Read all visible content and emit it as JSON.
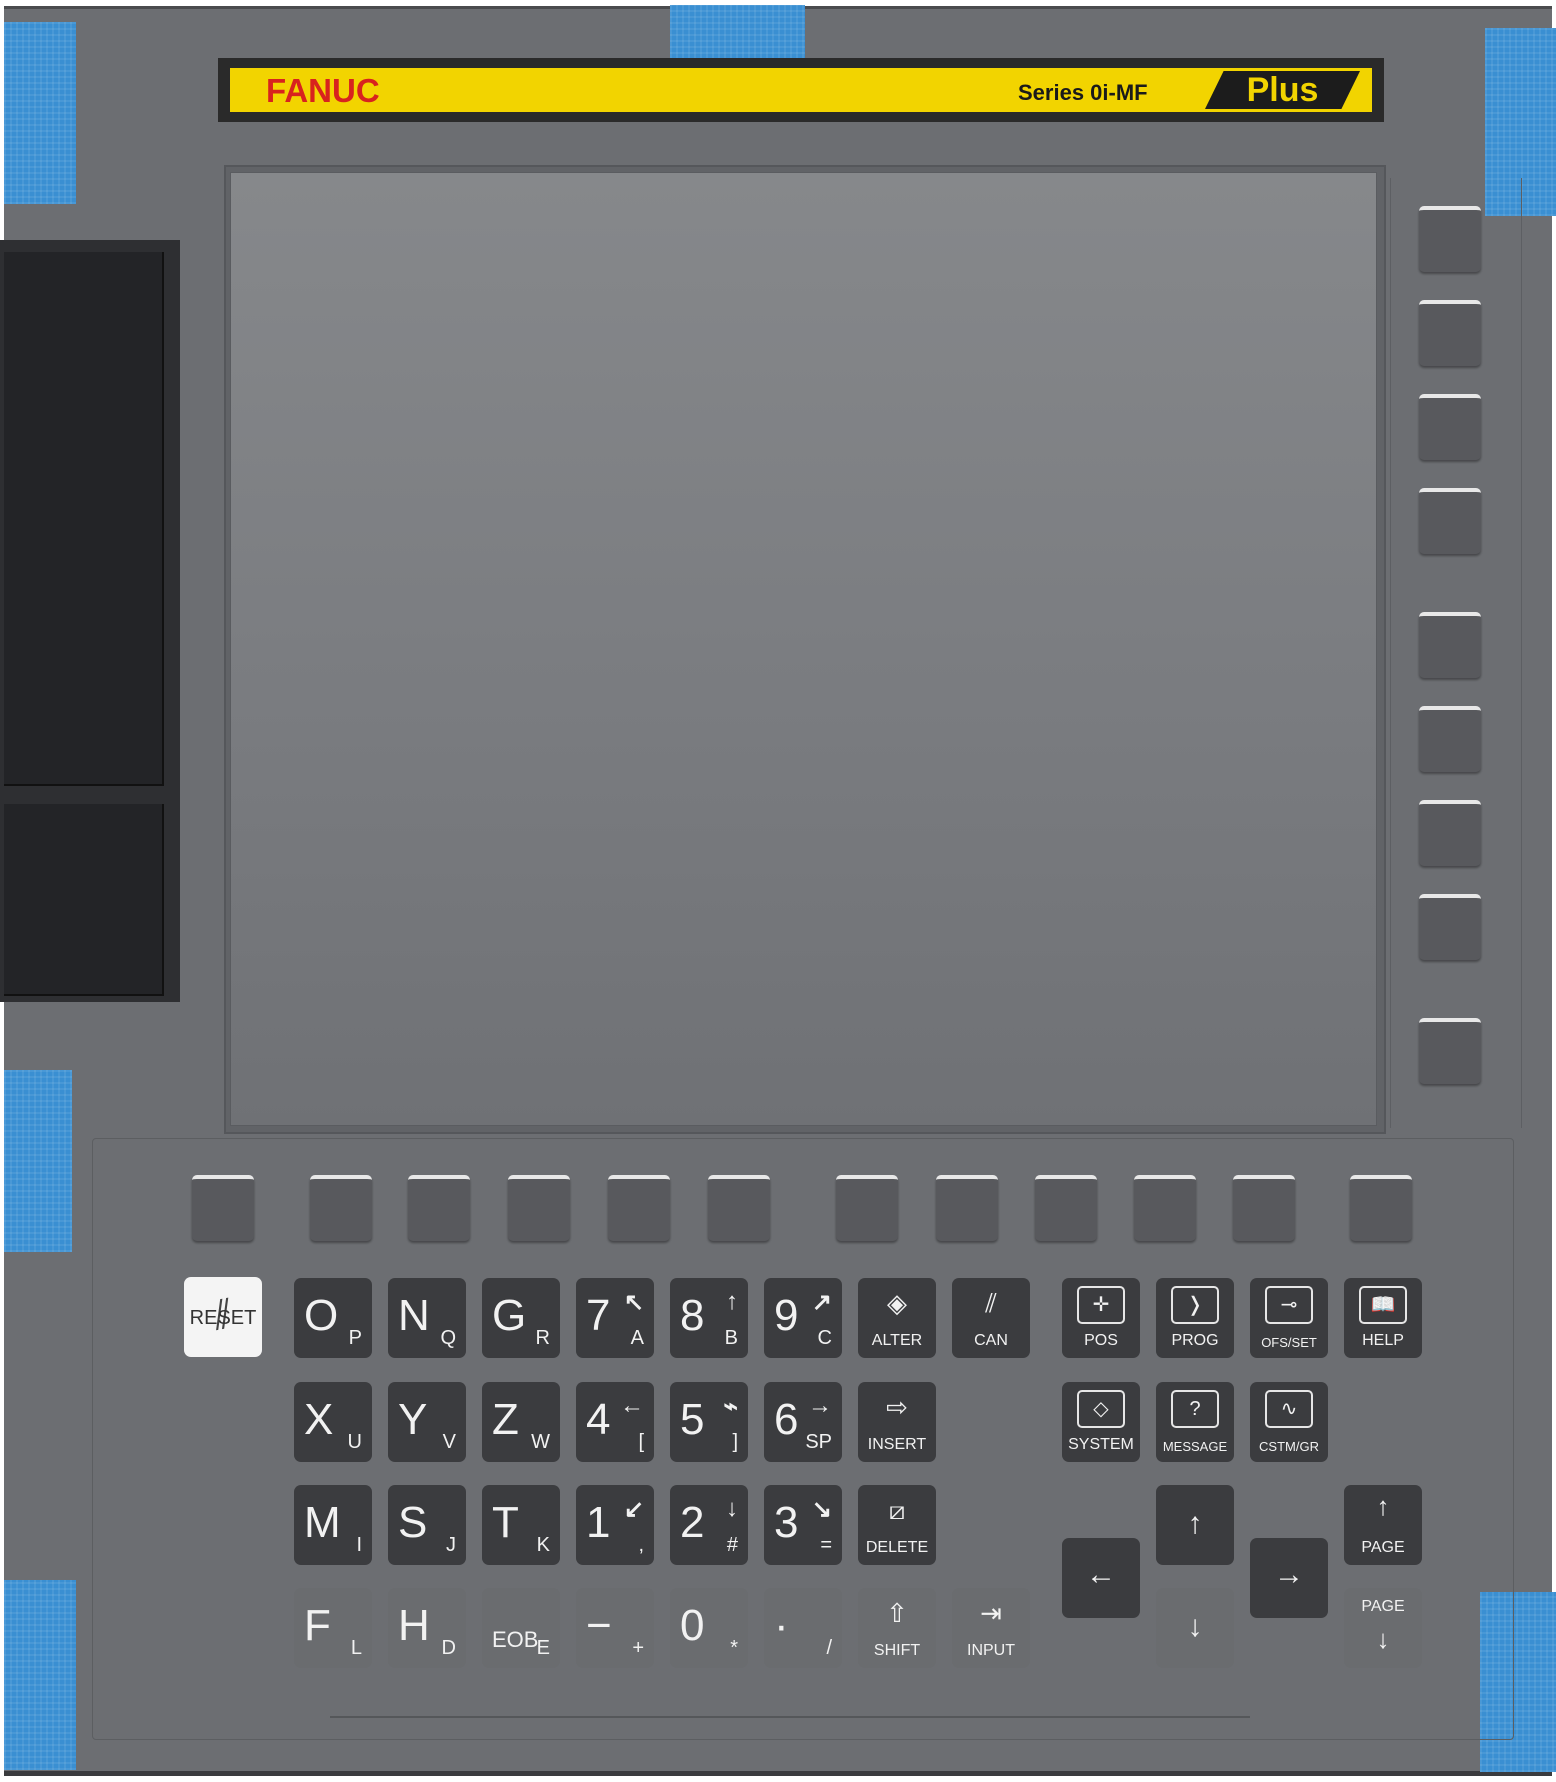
{
  "brand": {
    "logo": "FANUC",
    "series": "Series 0i-MF",
    "edition": "Plus",
    "colors": {
      "bar": "#f2d400",
      "logo": "#d8231e",
      "tape": "#3a8fd2"
    }
  },
  "screen": {
    "state": "off"
  },
  "right_softkeys": {
    "count": 9
  },
  "bottom_softkeys": {
    "count": 12
  },
  "reset": {
    "label": "RESET"
  },
  "address_keys": [
    {
      "main": "O",
      "sub": "P"
    },
    {
      "main": "N",
      "sub": "Q"
    },
    {
      "main": "G",
      "sub": "R"
    },
    {
      "main": "X",
      "sub": "U"
    },
    {
      "main": "Y",
      "sub": "V"
    },
    {
      "main": "Z",
      "sub": "W"
    },
    {
      "main": "M",
      "sub": "I"
    },
    {
      "main": "S",
      "sub": "J"
    },
    {
      "main": "T",
      "sub": "K"
    },
    {
      "main": "F",
      "sub": "L"
    },
    {
      "main": "H",
      "sub": "D"
    },
    {
      "main": "EOB",
      "sub": "E"
    }
  ],
  "numeric_keys": [
    {
      "main": "7",
      "sub": "A",
      "glyph": "↖"
    },
    {
      "main": "8",
      "sub": "B",
      "glyph": "↑"
    },
    {
      "main": "9",
      "sub": "C",
      "glyph": "↗"
    },
    {
      "main": "4",
      "sub": "[",
      "glyph": "←"
    },
    {
      "main": "5",
      "sub": "]",
      "glyph": "⌁"
    },
    {
      "main": "6",
      "sub": "SP",
      "glyph": "→"
    },
    {
      "main": "1",
      "sub": ",",
      "glyph": "↙"
    },
    {
      "main": "2",
      "sub": "#",
      "glyph": "↓"
    },
    {
      "main": "3",
      "sub": "=",
      "glyph": "↘"
    },
    {
      "main": "−",
      "sub": "+",
      "glyph": ""
    },
    {
      "main": "0",
      "sub": "*",
      "glyph": ""
    },
    {
      "main": "·",
      "sub": "/",
      "glyph": ""
    }
  ],
  "edit_keys": [
    {
      "label": "ALTER",
      "icon": "◈"
    },
    {
      "label": "CAN",
      "icon": "⫽"
    },
    {
      "label": "INSERT",
      "icon": "⇨"
    },
    {
      "label": "DELETE",
      "icon": "⧄"
    },
    {
      "label": "SHIFT",
      "icon": "⇧"
    },
    {
      "label": "INPUT",
      "icon": "⇥"
    }
  ],
  "function_keys": [
    {
      "label": "POS",
      "icon": "✛"
    },
    {
      "label": "PROG",
      "icon": "❭"
    },
    {
      "label": "OFS/SET",
      "icon": "⊸"
    },
    {
      "label": "HELP",
      "icon": "📖"
    },
    {
      "label": "SYSTEM",
      "icon": "◇"
    },
    {
      "label": "MESSAGE",
      "icon": "?"
    },
    {
      "label": "CSTM/GR",
      "icon": "∿"
    }
  ],
  "cursor_keys": {
    "up": "↑",
    "down": "↓",
    "left": "←",
    "right": "→"
  },
  "page_keys": [
    {
      "label": "PAGE",
      "arrow": "↑"
    },
    {
      "label": "PAGE",
      "arrow": "↓"
    }
  ]
}
